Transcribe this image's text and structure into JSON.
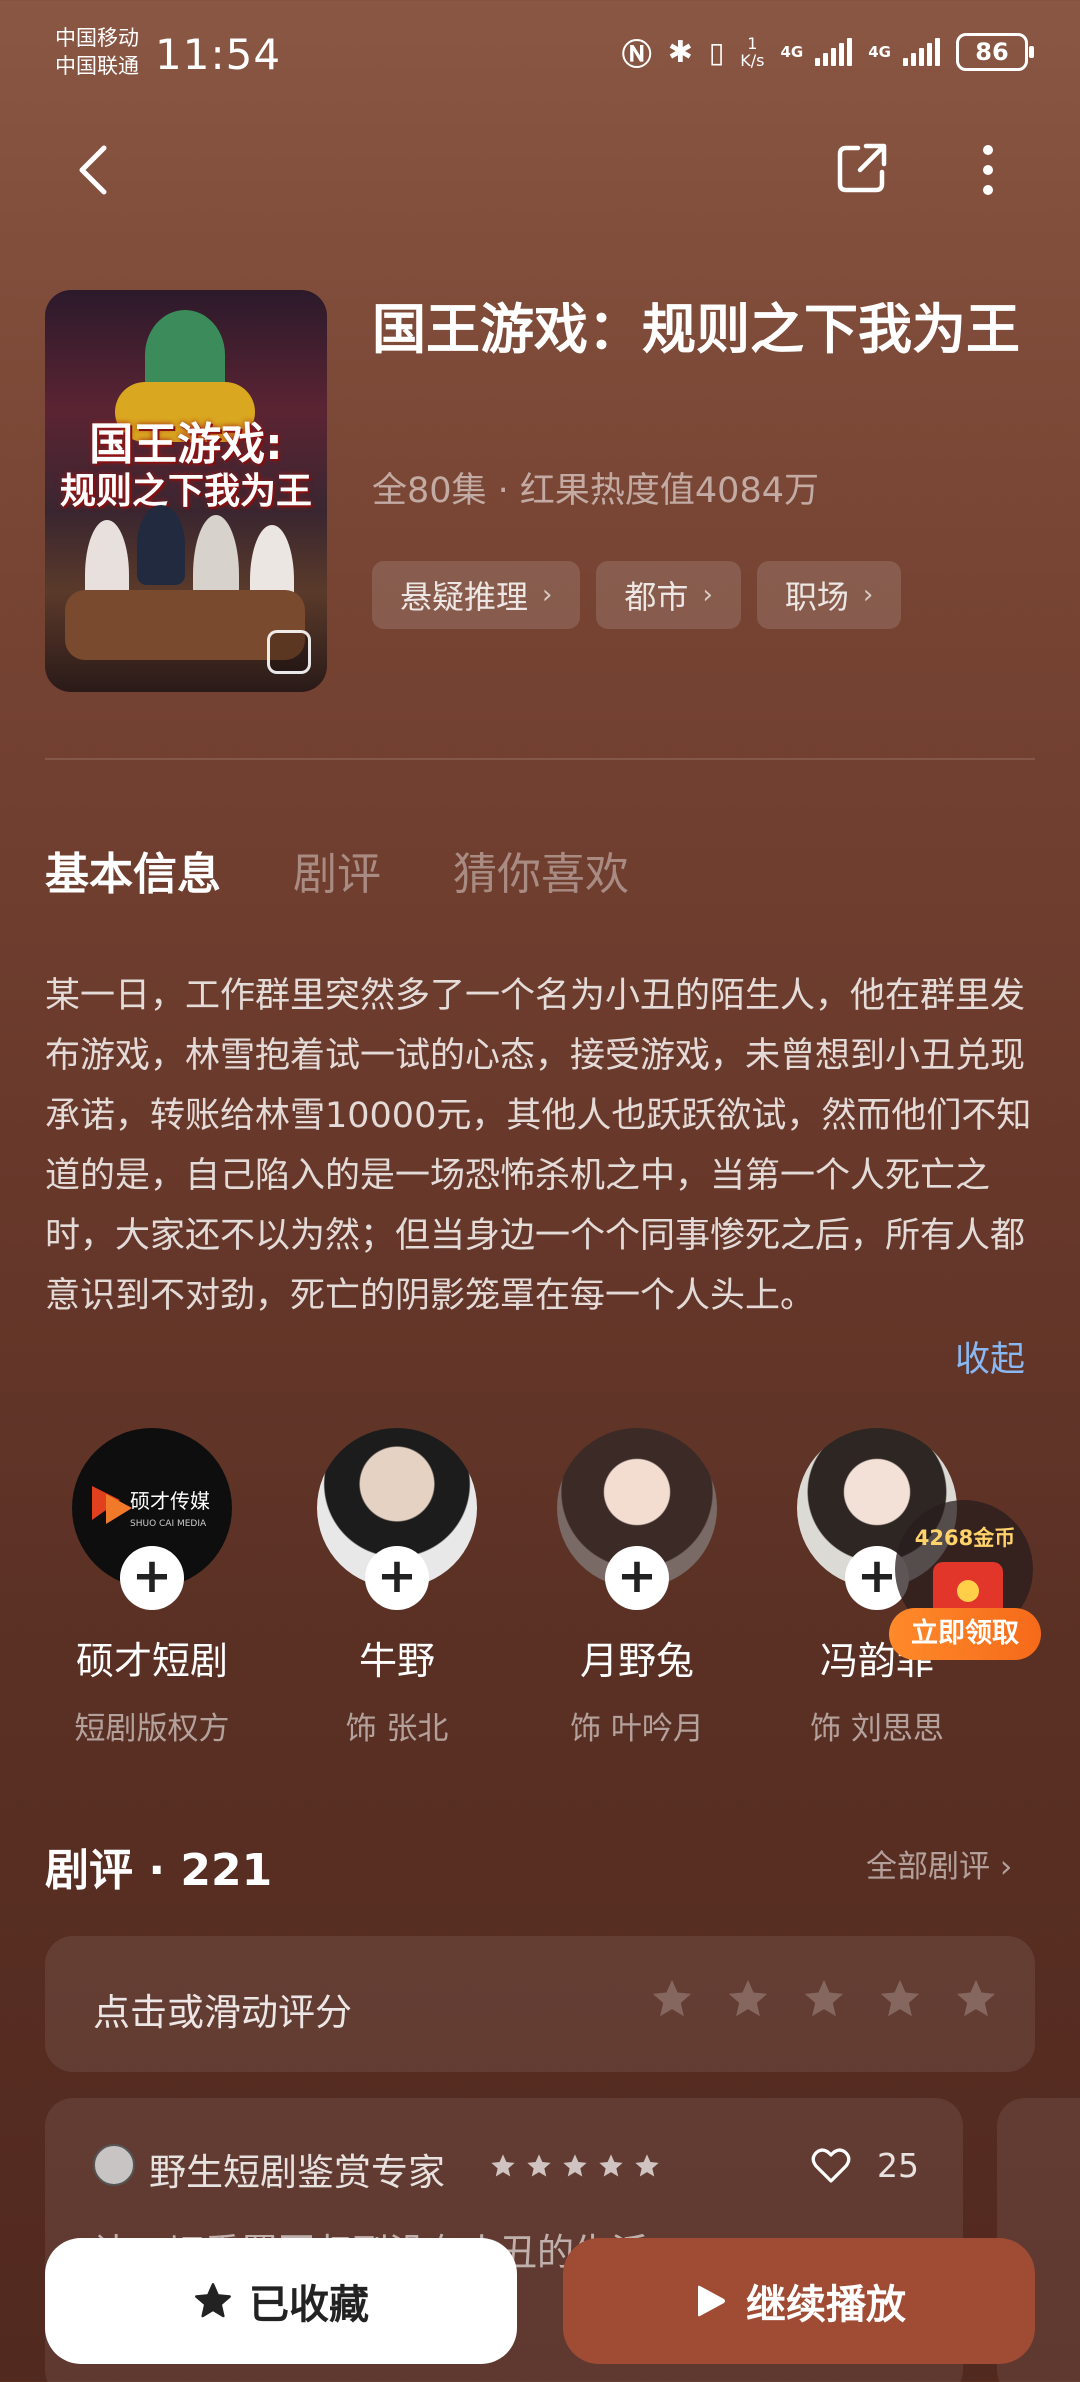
{
  "status_bar": {
    "carrier1": "中国移动",
    "carrier2": "中国联通",
    "time": "11:54",
    "net_speed_value": "1",
    "net_speed_unit": "K/s",
    "signal1": "4G",
    "signal2": "4G",
    "battery": "86"
  },
  "show": {
    "title": "国王游戏：规则之下我为王",
    "poster_line1": "国王游戏:",
    "poster_line2": "规则之下我为王",
    "meta": "全80集 · 红果热度值4084万",
    "tags": [
      "悬疑推理",
      "都市",
      "职场"
    ]
  },
  "tabs": [
    "基本信息",
    "剧评",
    "猜你喜欢"
  ],
  "synopsis": "某一日，工作群里突然多了一个名为小丑的陌生人，他在群里发布游戏，林雪抱着试一试的心态，接受游戏，未曾想到小丑兑现承诺，转账给林雪10000元，其他人也跃跃欲试，然而他们不知道的是，自己陷入的是一场恐怖杀机之中，当第一个人死亡之时，大家还不以为然；但当身边一个个同事惨死之后，所有人都意识到不对劲，死亡的阴影笼罩在每一个人头上。",
  "collapse_label": "收起",
  "cast": [
    {
      "name": "硕才短剧",
      "role": "短剧版权方",
      "logo_text": "硕才传媒",
      "logo_sub": "SHUO CAI MEDIA"
    },
    {
      "name": "牛野",
      "role": "饰 张北"
    },
    {
      "name": "月野兔",
      "role": "饰 叶吟月"
    },
    {
      "name": "冯韵菲",
      "role": "饰 刘思思"
    }
  ],
  "coin_promo": {
    "amount": "4268金币",
    "button": "立即领取"
  },
  "reviews": {
    "heading": "剧评 · 221",
    "all_label": "全部剧评",
    "rate_prompt": "点击或滑动评分",
    "first": {
      "user": "野生短剧鉴赏专家",
      "rating": 5,
      "likes": "25",
      "text": "让一切重置回归到没有小丑的生活"
    }
  },
  "actions": {
    "favorite": "已收藏",
    "play": "继续播放"
  },
  "colors": {
    "accent_link": "#89b8f2",
    "play_button": "#a04b34",
    "promo_orange": "#f56a1a"
  }
}
